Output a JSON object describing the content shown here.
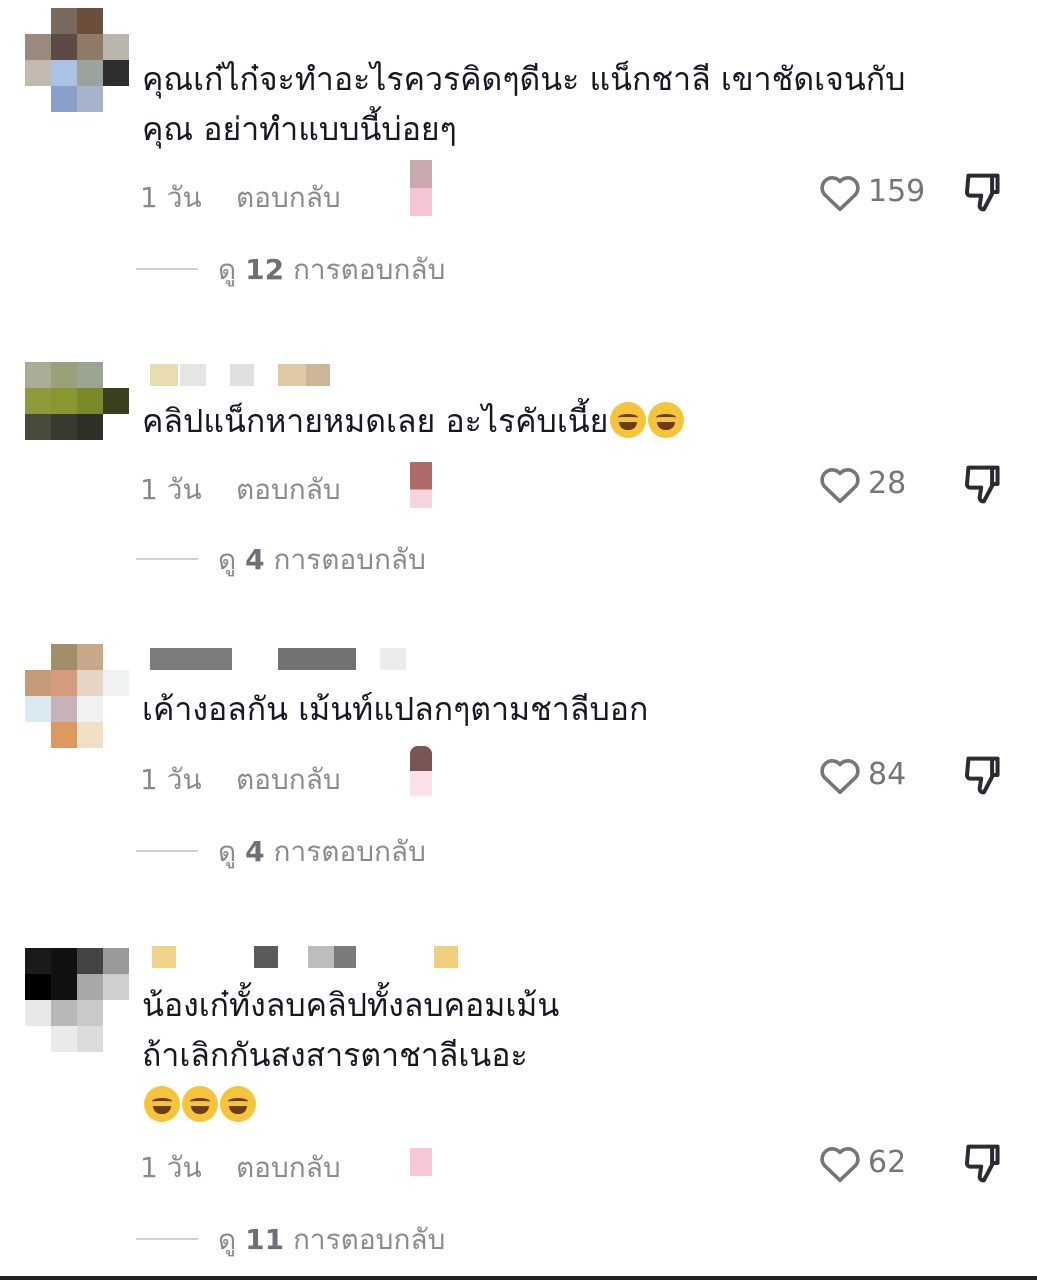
{
  "comments": [
    {
      "text": "คุณเก๋ไก๋จะทำอะไรควรคิดๆดีนะ แน็กชาลี เขาชัดเจนกับ\nคุณ อย่าทำแบบนี้บ่อยๆ",
      "time": "1 วัน",
      "reply_label": "ตอบกลับ",
      "likes": "159",
      "replies_prefix": "ดู",
      "replies_count": "12",
      "replies_suffix": "การตอบกลับ"
    },
    {
      "text": "คลิปแน็กหายหมดเลย อะไรคับเนี้ย",
      "time": "1 วัน",
      "reply_label": "ตอบกลับ",
      "likes": "28",
      "replies_prefix": "ดู",
      "replies_count": "4",
      "replies_suffix": "การตอบกลับ"
    },
    {
      "text": "เค้างอลกัน เม้นท์แปลกๆตามชาลีบอก",
      "time": "1 วัน",
      "reply_label": "ตอบกลับ",
      "likes": "84",
      "replies_prefix": "ดู",
      "replies_count": "4",
      "replies_suffix": "การตอบกลับ"
    },
    {
      "text": "น้องเก๋ทั้งลบคลิปทั้งลบคอมเม้น\nถ้าเลิกกันสงสารตาชาลีเนอะ",
      "time": "1 วัน",
      "reply_label": "ตอบกลับ",
      "likes": "62",
      "replies_prefix": "ดู",
      "replies_count": "11",
      "replies_suffix": "การตอบกลับ"
    }
  ],
  "icons": {
    "like": "heart-outline-icon",
    "dislike": "thumbs-down-icon",
    "emoji_laugh": "tears-of-joy-emoji",
    "emoji_smirk": "smirk-emoji"
  },
  "colors": {
    "text": "#161823",
    "meta": "#8a8b91",
    "divider": "#d0d0d4"
  }
}
